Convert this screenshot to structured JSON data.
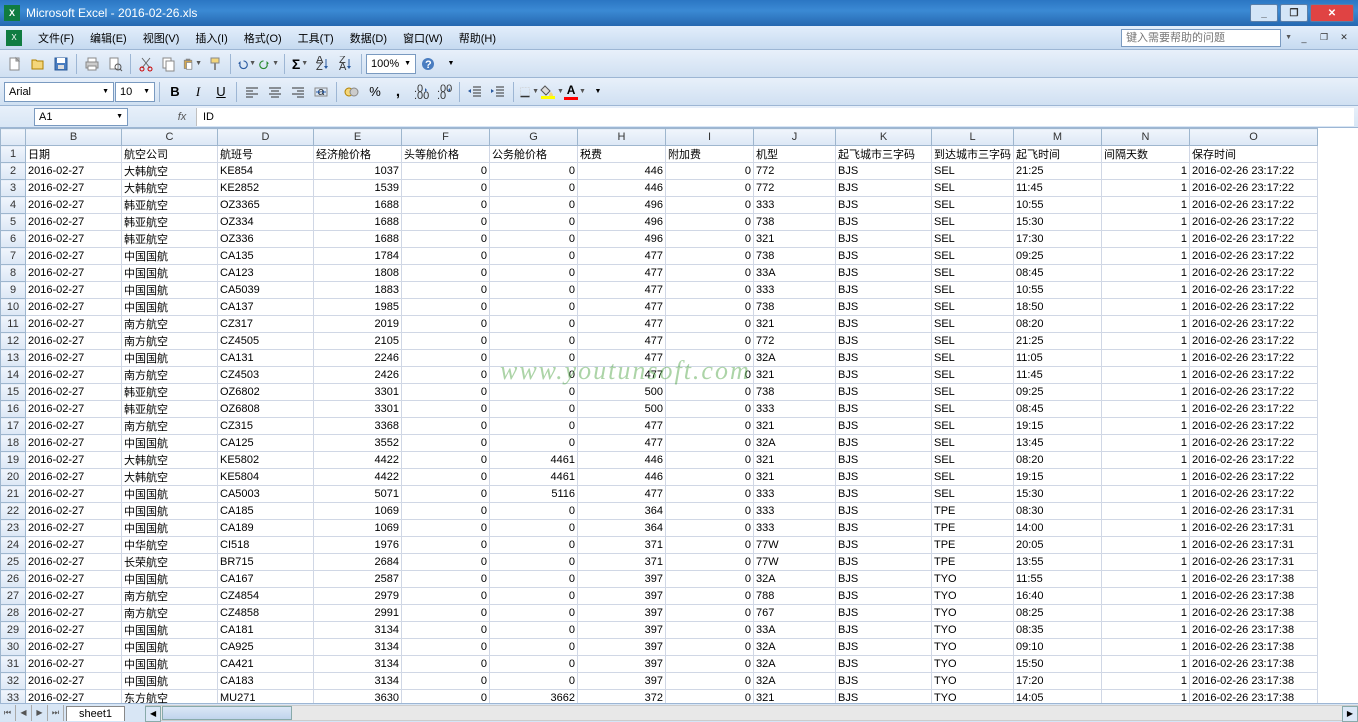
{
  "window": {
    "title": "Microsoft Excel - 2016-02-26.xls"
  },
  "menu": {
    "items": [
      "文件(F)",
      "编辑(E)",
      "视图(V)",
      "插入(I)",
      "格式(O)",
      "工具(T)",
      "数据(D)",
      "窗口(W)",
      "帮助(H)"
    ],
    "help_placeholder": "键入需要帮助的问题"
  },
  "toolbar": {
    "zoom": "100%"
  },
  "font": {
    "name": "Arial",
    "size": "10"
  },
  "namebox": "A1",
  "formula": "ID",
  "columns": [
    {
      "letter": "B",
      "width": 96
    },
    {
      "letter": "C",
      "width": 96
    },
    {
      "letter": "D",
      "width": 96
    },
    {
      "letter": "E",
      "width": 88
    },
    {
      "letter": "F",
      "width": 88
    },
    {
      "letter": "G",
      "width": 88
    },
    {
      "letter": "H",
      "width": 88
    },
    {
      "letter": "I",
      "width": 88
    },
    {
      "letter": "J",
      "width": 82
    },
    {
      "letter": "K",
      "width": 96
    },
    {
      "letter": "L",
      "width": 82
    },
    {
      "letter": "M",
      "width": 88
    },
    {
      "letter": "N",
      "width": 88
    },
    {
      "letter": "O",
      "width": 128
    }
  ],
  "headers": [
    "日期",
    "航空公司",
    "航班号",
    "经济舱价格",
    "头等舱价格",
    "公务舱价格",
    "税费",
    "附加费",
    "机型",
    "起飞城市三字码",
    "到达城市三字码",
    "起飞时间",
    "间隔天数",
    "保存时间"
  ],
  "rows": [
    [
      "2016-02-27",
      "大韩航空",
      "KE854",
      "1037",
      "0",
      "0",
      "446",
      "0",
      "772",
      "BJS",
      "SEL",
      "21:25",
      "1",
      "2016-02-26 23:17:22"
    ],
    [
      "2016-02-27",
      "大韩航空",
      "KE2852",
      "1539",
      "0",
      "0",
      "446",
      "0",
      "772",
      "BJS",
      "SEL",
      "11:45",
      "1",
      "2016-02-26 23:17:22"
    ],
    [
      "2016-02-27",
      "韩亚航空",
      "OZ3365",
      "1688",
      "0",
      "0",
      "496",
      "0",
      "333",
      "BJS",
      "SEL",
      "10:55",
      "1",
      "2016-02-26 23:17:22"
    ],
    [
      "2016-02-27",
      "韩亚航空",
      "OZ334",
      "1688",
      "0",
      "0",
      "496",
      "0",
      "738",
      "BJS",
      "SEL",
      "15:30",
      "1",
      "2016-02-26 23:17:22"
    ],
    [
      "2016-02-27",
      "韩亚航空",
      "OZ336",
      "1688",
      "0",
      "0",
      "496",
      "0",
      "321",
      "BJS",
      "SEL",
      "17:30",
      "1",
      "2016-02-26 23:17:22"
    ],
    [
      "2016-02-27",
      "中国国航",
      "CA135",
      "1784",
      "0",
      "0",
      "477",
      "0",
      "738",
      "BJS",
      "SEL",
      "09:25",
      "1",
      "2016-02-26 23:17:22"
    ],
    [
      "2016-02-27",
      "中国国航",
      "CA123",
      "1808",
      "0",
      "0",
      "477",
      "0",
      "33A",
      "BJS",
      "SEL",
      "08:45",
      "1",
      "2016-02-26 23:17:22"
    ],
    [
      "2016-02-27",
      "中国国航",
      "CA5039",
      "1883",
      "0",
      "0",
      "477",
      "0",
      "333",
      "BJS",
      "SEL",
      "10:55",
      "1",
      "2016-02-26 23:17:22"
    ],
    [
      "2016-02-27",
      "中国国航",
      "CA137",
      "1985",
      "0",
      "0",
      "477",
      "0",
      "738",
      "BJS",
      "SEL",
      "18:50",
      "1",
      "2016-02-26 23:17:22"
    ],
    [
      "2016-02-27",
      "南方航空",
      "CZ317",
      "2019",
      "0",
      "0",
      "477",
      "0",
      "321",
      "BJS",
      "SEL",
      "08:20",
      "1",
      "2016-02-26 23:17:22"
    ],
    [
      "2016-02-27",
      "南方航空",
      "CZ4505",
      "2105",
      "0",
      "0",
      "477",
      "0",
      "772",
      "BJS",
      "SEL",
      "21:25",
      "1",
      "2016-02-26 23:17:22"
    ],
    [
      "2016-02-27",
      "中国国航",
      "CA131",
      "2246",
      "0",
      "0",
      "477",
      "0",
      "32A",
      "BJS",
      "SEL",
      "11:05",
      "1",
      "2016-02-26 23:17:22"
    ],
    [
      "2016-02-27",
      "南方航空",
      "CZ4503",
      "2426",
      "0",
      "0",
      "477",
      "0",
      "321",
      "BJS",
      "SEL",
      "11:45",
      "1",
      "2016-02-26 23:17:22"
    ],
    [
      "2016-02-27",
      "韩亚航空",
      "OZ6802",
      "3301",
      "0",
      "0",
      "500",
      "0",
      "738",
      "BJS",
      "SEL",
      "09:25",
      "1",
      "2016-02-26 23:17:22"
    ],
    [
      "2016-02-27",
      "韩亚航空",
      "OZ6808",
      "3301",
      "0",
      "0",
      "500",
      "0",
      "333",
      "BJS",
      "SEL",
      "08:45",
      "1",
      "2016-02-26 23:17:22"
    ],
    [
      "2016-02-27",
      "南方航空",
      "CZ315",
      "3368",
      "0",
      "0",
      "477",
      "0",
      "321",
      "BJS",
      "SEL",
      "19:15",
      "1",
      "2016-02-26 23:17:22"
    ],
    [
      "2016-02-27",
      "中国国航",
      "CA125",
      "3552",
      "0",
      "0",
      "477",
      "0",
      "32A",
      "BJS",
      "SEL",
      "13:45",
      "1",
      "2016-02-26 23:17:22"
    ],
    [
      "2016-02-27",
      "大韩航空",
      "KE5802",
      "4422",
      "0",
      "4461",
      "446",
      "0",
      "321",
      "BJS",
      "SEL",
      "08:20",
      "1",
      "2016-02-26 23:17:22"
    ],
    [
      "2016-02-27",
      "大韩航空",
      "KE5804",
      "4422",
      "0",
      "4461",
      "446",
      "0",
      "321",
      "BJS",
      "SEL",
      "19:15",
      "1",
      "2016-02-26 23:17:22"
    ],
    [
      "2016-02-27",
      "中国国航",
      "CA5003",
      "5071",
      "0",
      "5116",
      "477",
      "0",
      "333",
      "BJS",
      "SEL",
      "15:30",
      "1",
      "2016-02-26 23:17:22"
    ],
    [
      "2016-02-27",
      "中国国航",
      "CA185",
      "1069",
      "0",
      "0",
      "364",
      "0",
      "333",
      "BJS",
      "TPE",
      "08:30",
      "1",
      "2016-02-26 23:17:31"
    ],
    [
      "2016-02-27",
      "中国国航",
      "CA189",
      "1069",
      "0",
      "0",
      "364",
      "0",
      "333",
      "BJS",
      "TPE",
      "14:00",
      "1",
      "2016-02-26 23:17:31"
    ],
    [
      "2016-02-27",
      "中华航空",
      "CI518",
      "1976",
      "0",
      "0",
      "371",
      "0",
      "77W",
      "BJS",
      "TPE",
      "20:05",
      "1",
      "2016-02-26 23:17:31"
    ],
    [
      "2016-02-27",
      "长荣航空",
      "BR715",
      "2684",
      "0",
      "0",
      "371",
      "0",
      "77W",
      "BJS",
      "TPE",
      "13:55",
      "1",
      "2016-02-26 23:17:31"
    ],
    [
      "2016-02-27",
      "中国国航",
      "CA167",
      "2587",
      "0",
      "0",
      "397",
      "0",
      "32A",
      "BJS",
      "TYO",
      "11:55",
      "1",
      "2016-02-26 23:17:38"
    ],
    [
      "2016-02-27",
      "南方航空",
      "CZ4854",
      "2979",
      "0",
      "0",
      "397",
      "0",
      "788",
      "BJS",
      "TYO",
      "16:40",
      "1",
      "2016-02-26 23:17:38"
    ],
    [
      "2016-02-27",
      "南方航空",
      "CZ4858",
      "2991",
      "0",
      "0",
      "397",
      "0",
      "767",
      "BJS",
      "TYO",
      "08:25",
      "1",
      "2016-02-26 23:17:38"
    ],
    [
      "2016-02-27",
      "中国国航",
      "CA181",
      "3134",
      "0",
      "0",
      "397",
      "0",
      "33A",
      "BJS",
      "TYO",
      "08:35",
      "1",
      "2016-02-26 23:17:38"
    ],
    [
      "2016-02-27",
      "中国国航",
      "CA925",
      "3134",
      "0",
      "0",
      "397",
      "0",
      "32A",
      "BJS",
      "TYO",
      "09:10",
      "1",
      "2016-02-26 23:17:38"
    ],
    [
      "2016-02-27",
      "中国国航",
      "CA421",
      "3134",
      "0",
      "0",
      "397",
      "0",
      "32A",
      "BJS",
      "TYO",
      "15:50",
      "1",
      "2016-02-26 23:17:38"
    ],
    [
      "2016-02-27",
      "中国国航",
      "CA183",
      "3134",
      "0",
      "0",
      "397",
      "0",
      "32A",
      "BJS",
      "TYO",
      "17:20",
      "1",
      "2016-02-26 23:17:38"
    ],
    [
      "2016-02-27",
      "东方航空",
      "MU271",
      "3630",
      "0",
      "3662",
      "372",
      "0",
      "321",
      "BJS",
      "TYO",
      "14:05",
      "1",
      "2016-02-26 23:17:38"
    ]
  ],
  "numeric_cols": [
    3,
    4,
    5,
    6,
    7,
    12
  ],
  "sheet": {
    "name": "sheet1"
  },
  "watermark": "www.youtunsoft.com"
}
